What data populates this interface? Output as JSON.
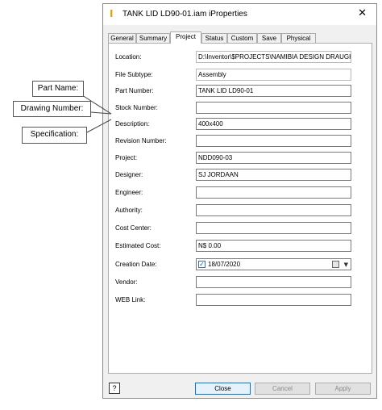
{
  "window": {
    "title": "TANK LID LD90-01.iam iProperties",
    "app_icon": "inventor-icon",
    "close_glyph": "✕"
  },
  "tabs": [
    "General",
    "Summary",
    "Project",
    "Status",
    "Custom",
    "Save",
    "Physical"
  ],
  "active_tab": "Project",
  "fields": [
    {
      "label": "Location:",
      "value": ""
    },
    {
      "label": "File Subtype:",
      "value": ""
    },
    {
      "label": "Part Number:",
      "value": "TANK LID LD90-01"
    },
    {
      "label": "Stock Number:",
      "value": ""
    },
    {
      "label": "Description:",
      "value": "400x400"
    },
    {
      "label": "Revision Number:",
      "value": ""
    },
    {
      "label": "Project:",
      "value": "NDD090-03"
    },
    {
      "label": "Designer:",
      "value": "SJ JORDAAN"
    },
    {
      "label": "Engineer:",
      "value": ""
    },
    {
      "label": "Authority:",
      "value": ""
    },
    {
      "label": "Cost Center:",
      "value": ""
    },
    {
      "label": "Estimated Cost:",
      "value": "N$ 0.00"
    },
    {
      "label": "Creation Date:",
      "value": ""
    },
    {
      "label": "Vendor:",
      "value": ""
    },
    {
      "label": "WEB Link:",
      "value": ""
    }
  ],
  "readonly": {
    "location": "D:\\Inventor\\$PROJECTS\\NAMIBIA DESIGN DRAUGHTING",
    "file_subtype": "Assembly"
  },
  "creation_date": {
    "checked": true,
    "check_glyph": "✓",
    "value": "18/07/2020",
    "dropdown_glyph": "▼"
  },
  "buttons": {
    "help": "?",
    "close": "Close",
    "cancel": "Cancel",
    "apply": "Apply"
  },
  "callouts": {
    "part_name": "Part Name:",
    "drawing_number": "Drawing Number:",
    "specification": "Specification:"
  }
}
